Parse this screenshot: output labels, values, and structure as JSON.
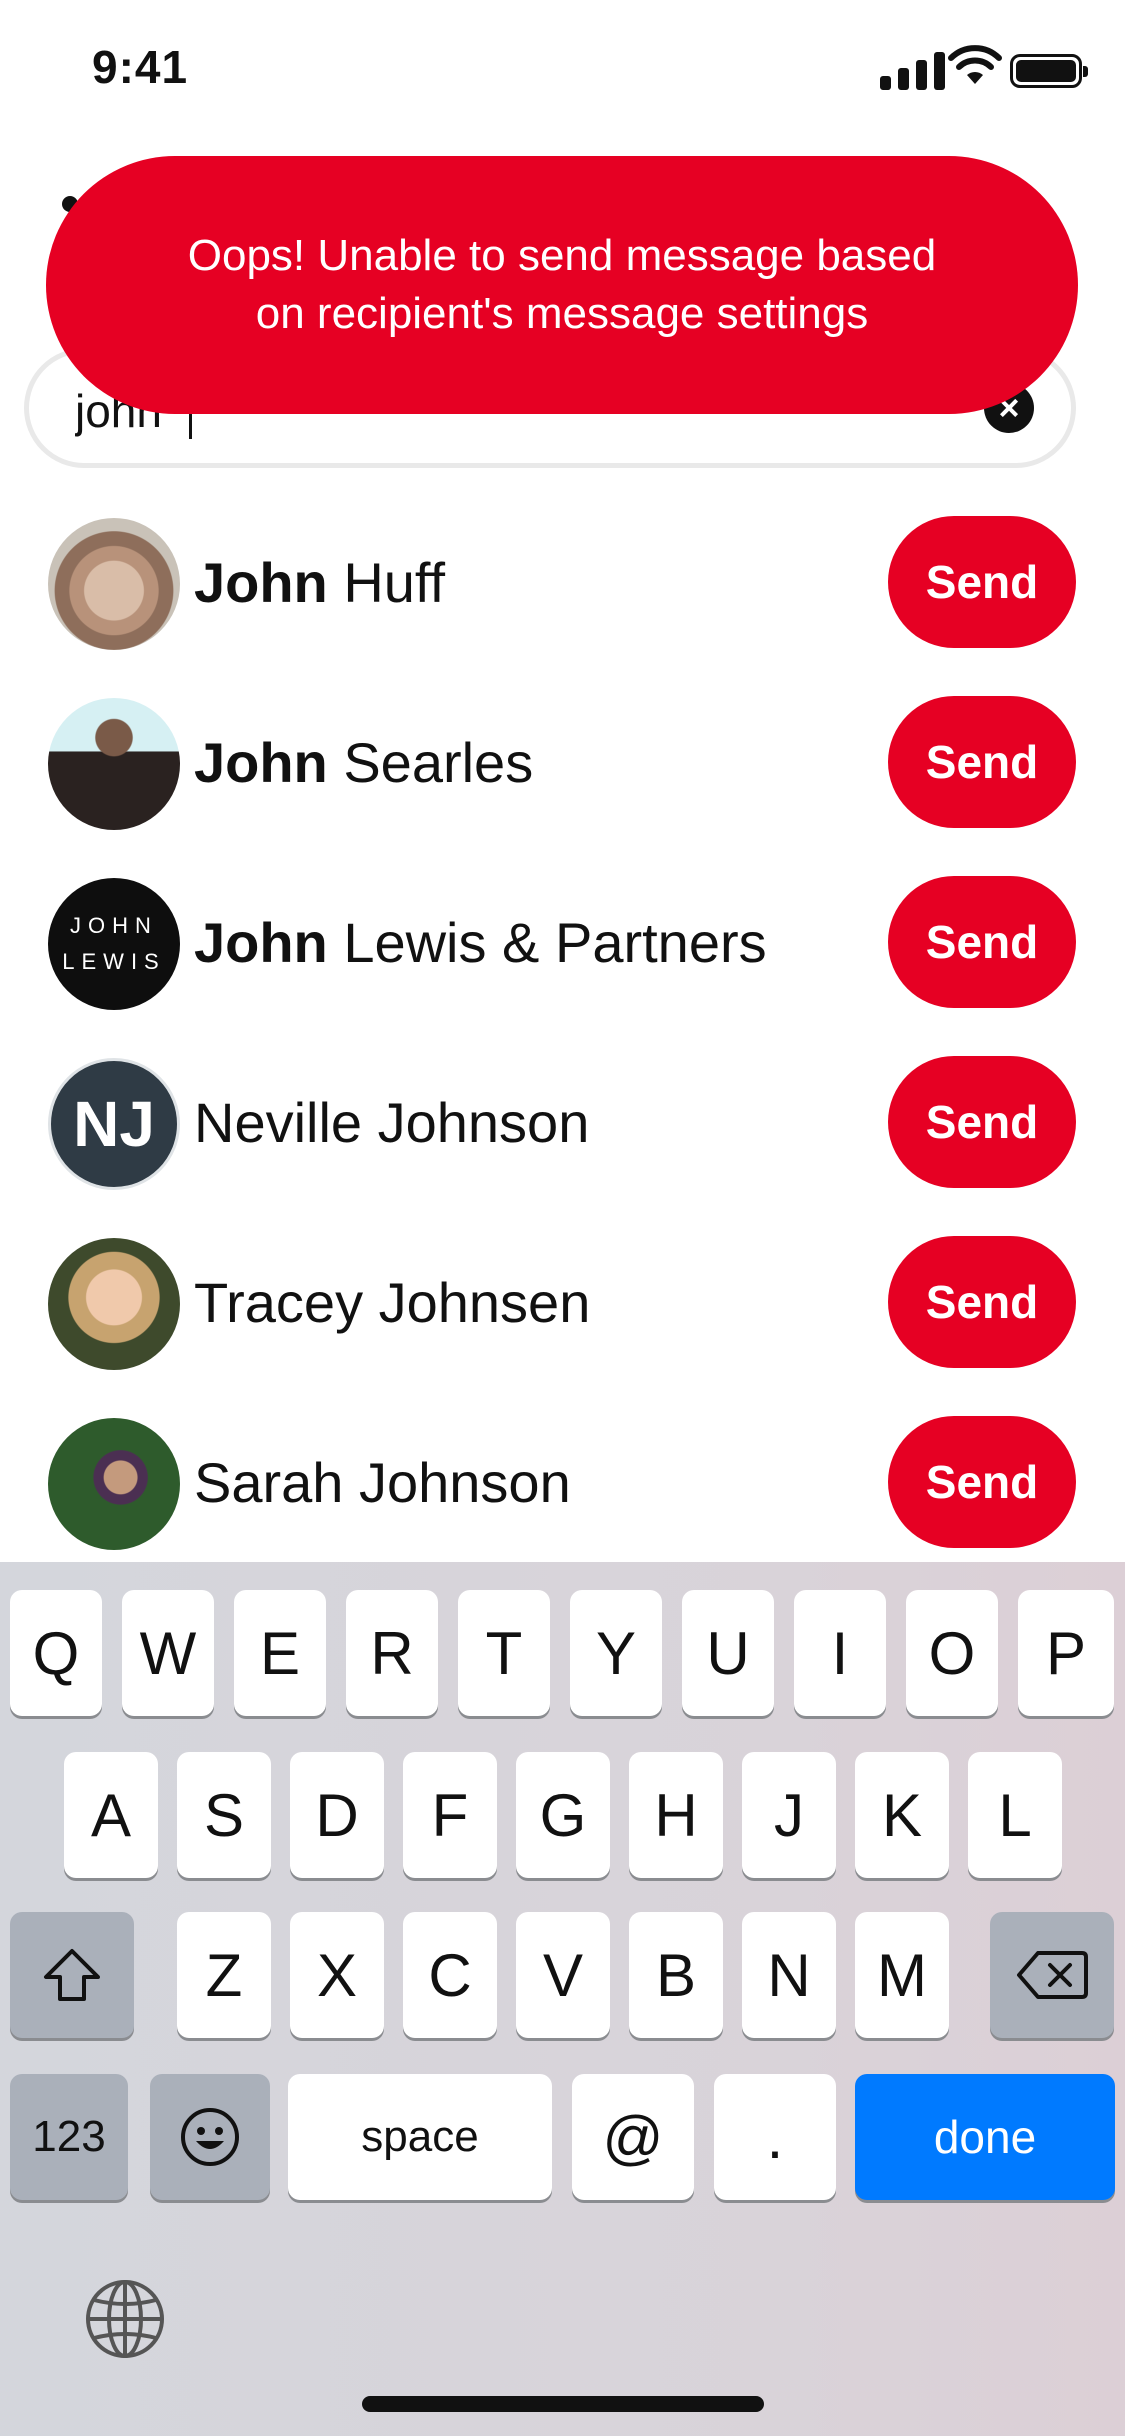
{
  "status_bar": {
    "time": "9:41"
  },
  "toast": {
    "message": "Oops! Unable to send message based\non recipient's message settings",
    "color": "#e60023"
  },
  "search": {
    "value": "john",
    "clear_icon": "clear-icon"
  },
  "results": [
    {
      "bold": "John",
      "rest": " Huff",
      "avatar": "photo-armchair",
      "button": "Send"
    },
    {
      "bold": "John",
      "rest": " Searles",
      "avatar": "photo-person",
      "button": "Send"
    },
    {
      "bold": "John",
      "rest": " Lewis & Partners",
      "avatar": "john-lewis-logo",
      "logo_line1": "JOHN",
      "logo_line2": "LEWIS",
      "button": "Send"
    },
    {
      "bold": "",
      "rest": "Neville Johnson",
      "avatar": "initials",
      "initials": "NJ",
      "button": "Send"
    },
    {
      "bold": "",
      "rest": "Tracey Johnsen",
      "avatar": "photo-person",
      "button": "Send"
    },
    {
      "bold": "",
      "rest": "Sarah Johnson",
      "avatar": "photo-person",
      "button": "Send"
    }
  ],
  "keyboard": {
    "row1": [
      "Q",
      "W",
      "E",
      "R",
      "T",
      "Y",
      "U",
      "I",
      "O",
      "P"
    ],
    "row2": [
      "A",
      "S",
      "D",
      "F",
      "G",
      "H",
      "J",
      "K",
      "L"
    ],
    "row3": [
      "Z",
      "X",
      "C",
      "V",
      "B",
      "N",
      "M"
    ],
    "numbers": "123",
    "space": "space",
    "at": "@",
    "period": ".",
    "done": "done",
    "shift_icon": "shift-icon",
    "backspace_icon": "backspace-icon",
    "emoji_icon": "emoji-icon",
    "globe_icon": "globe-icon",
    "accent": "#007aff"
  }
}
